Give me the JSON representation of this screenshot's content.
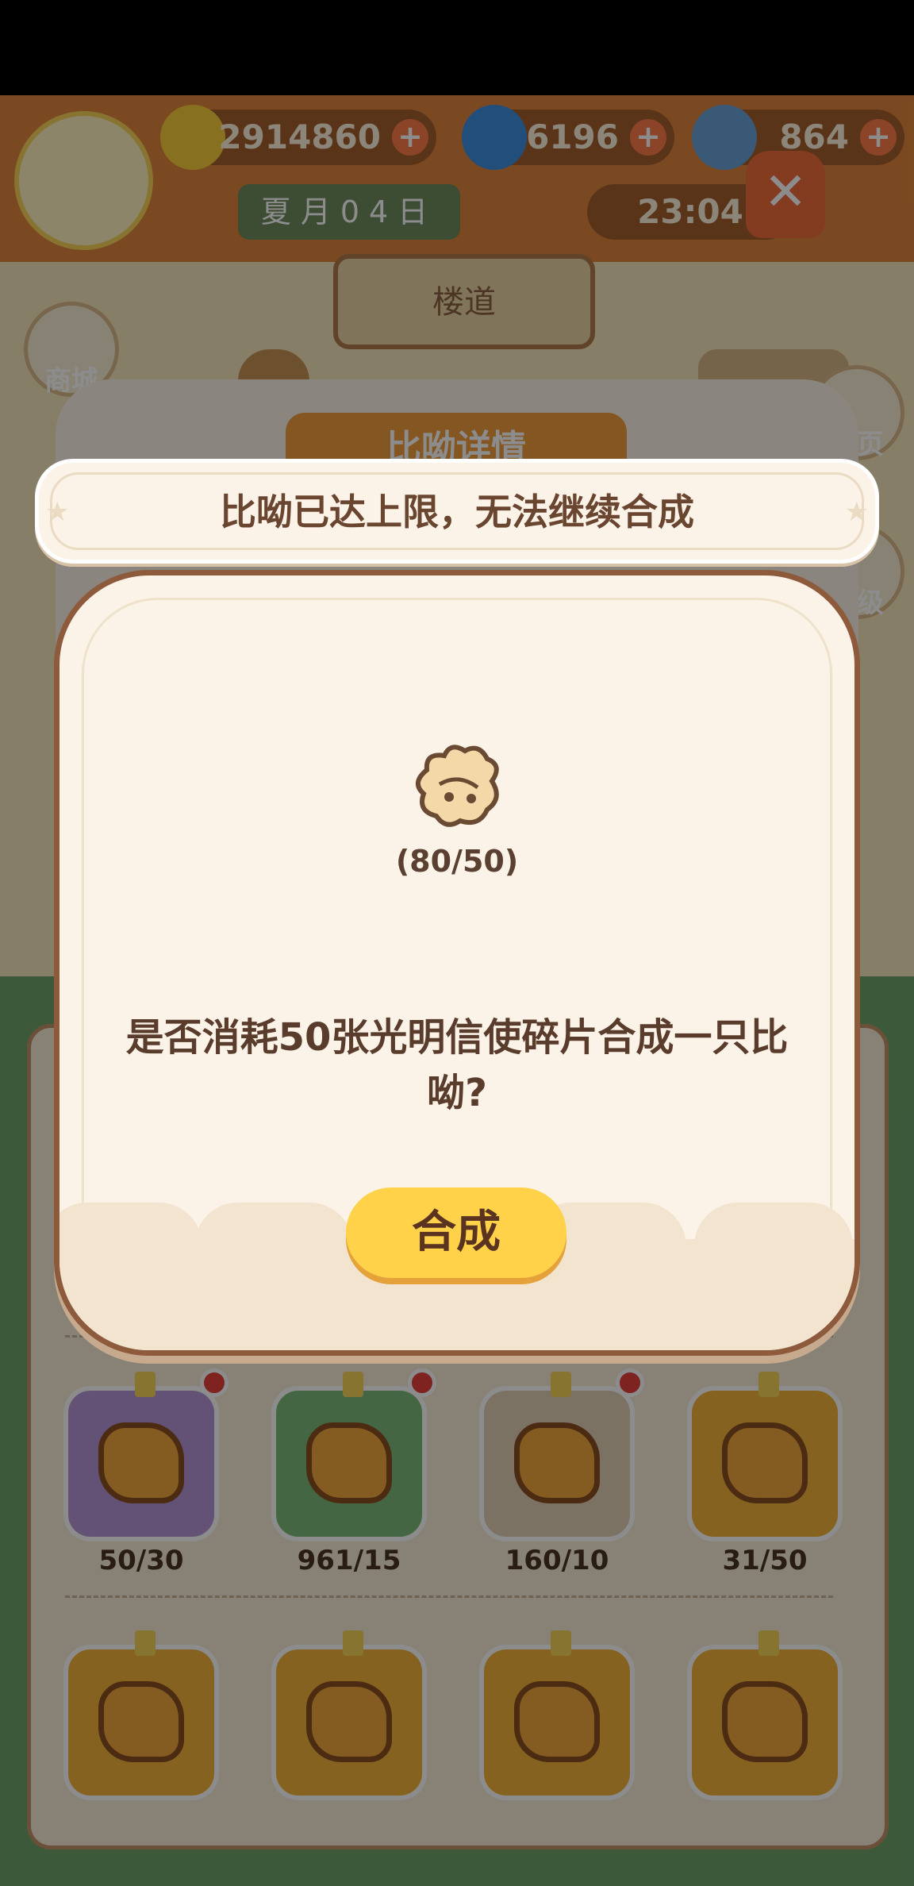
{
  "hud": {
    "bananas": "2914860",
    "gems": "6196",
    "tickets": "864",
    "date": "夏月04日",
    "time": "23:04",
    "location": "楼道"
  },
  "side_buttons": [
    "商城",
    "主页",
    "等级"
  ],
  "background_dialog": {
    "title": "比呦详情",
    "items": [
      {
        "count": "50/30",
        "color": "#b596d6",
        "has_dot": true
      },
      {
        "count": "961/15",
        "color": "#7fbb7a",
        "has_dot": true
      },
      {
        "count": "160/10",
        "color": "#e2cfb4",
        "has_dot": true
      },
      {
        "count": "31/50",
        "color": "#f4b23d",
        "has_dot": false
      },
      {
        "count": "",
        "color": "#f4b23d",
        "has_dot": false
      },
      {
        "count": "",
        "color": "#f4b23d",
        "has_dot": false
      },
      {
        "count": "",
        "color": "#f4b23d",
        "has_dot": false
      },
      {
        "count": "",
        "color": "#f4b23d",
        "has_dot": false
      }
    ]
  },
  "toast": {
    "message": "比呦已达上限，无法继续合成"
  },
  "dialog": {
    "fragment_ratio": "(80/50)",
    "question": "是否消耗50张光明信使碎片合成一只比呦?",
    "confirm_label": "合成",
    "icon": "puzzle-fragment-icon"
  }
}
